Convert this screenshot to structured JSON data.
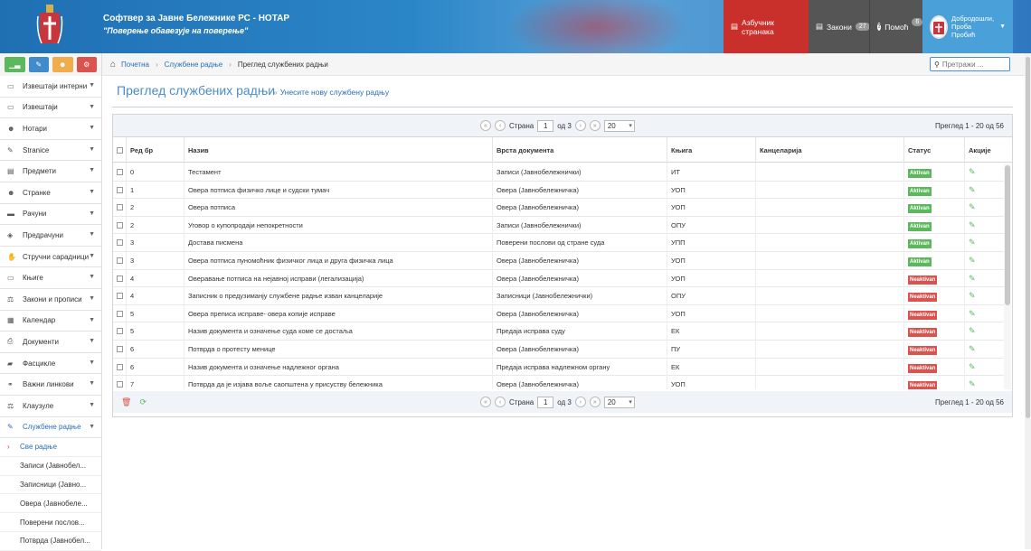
{
  "header": {
    "app_title": "Софтвер за Јавне Бележнике РС - НОТАР",
    "app_subtitle": "\"Поверење обавезује на поверење\"",
    "btn_alphabet": "Азбучник странака",
    "btn_laws": "Закони",
    "laws_count": "27",
    "btn_help": "Помоћ",
    "help_count": "6",
    "user_greeting": "Добродошли,",
    "user_first": "Проба",
    "user_last": "Пробић"
  },
  "sidebar": {
    "items": [
      {
        "label": "Извештаји интерни",
        "icon": "book-icon"
      },
      {
        "label": "Извештаји",
        "icon": "book-icon"
      },
      {
        "label": "Нотари",
        "icon": "users-icon"
      },
      {
        "label": "Stranice",
        "icon": "edit-icon"
      },
      {
        "label": "Предмети",
        "icon": "briefcase-icon"
      },
      {
        "label": "Странке",
        "icon": "users-icon"
      },
      {
        "label": "Рачуни",
        "icon": "credit-card-icon"
      },
      {
        "label": "Предрачуни",
        "icon": "tag-icon"
      },
      {
        "label": "Стручни сарадници",
        "icon": "handshake-icon"
      },
      {
        "label": "Књиге",
        "icon": "book-icon"
      },
      {
        "label": "Закони и прописи",
        "icon": "gavel-icon"
      },
      {
        "label": "Календар",
        "icon": "calendar-icon"
      },
      {
        "label": "Документи",
        "icon": "print-icon"
      },
      {
        "label": "Фасцикле",
        "icon": "folder-icon"
      },
      {
        "label": "Важни линкови",
        "icon": "link-icon"
      },
      {
        "label": "Клаузуле",
        "icon": "gavel-icon"
      },
      {
        "label": "Службене радње",
        "icon": "pencil-icon"
      }
    ],
    "subitems": [
      "Све радње",
      "Записи (Јавнобел...",
      "Записници (Јавно...",
      "Овера (Јавнобеле...",
      "Поверени послов...",
      "Потврда (Јавнобел..."
    ]
  },
  "breadcrumb": {
    "home": "Почетна",
    "section": "Службене радње",
    "current": "Преглед службених радњи"
  },
  "search": {
    "placeholder": "Претражи ..."
  },
  "page": {
    "title": "Преглед службених радњи",
    "new_link": "Унесите нову службену радњу"
  },
  "pager": {
    "page_label": "Страна",
    "page_value": "1",
    "of_label": "од 3",
    "per_page": "20",
    "range": "Преглед 1 - 20 од 56"
  },
  "columns": [
    "Ред бр",
    "Назив",
    "Врста документа",
    "Књига",
    "Канцеларија",
    "Статус",
    "Акције"
  ],
  "rows": [
    {
      "no": "0",
      "name": "Тестамент",
      "doctype": "Записи (Јавнобележнички)",
      "book": "ИТ",
      "office": "",
      "status": "Aktivan",
      "active": true
    },
    {
      "no": "1",
      "name": "Овера потписа физичко лице и судски тумач",
      "doctype": "Овера (Јавнобележничка)",
      "book": "УОП",
      "office": "",
      "status": "Aktivan",
      "active": true
    },
    {
      "no": "2",
      "name": "Овера потписа",
      "doctype": "Овера (Јавнобележничка)",
      "book": "УОП",
      "office": "",
      "status": "Aktivan",
      "active": true
    },
    {
      "no": "2",
      "name": "Уговор о купопродаји непокретности",
      "doctype": "Записи (Јавнобележнички)",
      "book": "ОПУ",
      "office": "",
      "status": "Aktivan",
      "active": true
    },
    {
      "no": "3",
      "name": "Достава писмена",
      "doctype": "Поверени послови од стране суда",
      "book": "УПП",
      "office": "",
      "status": "Aktivan",
      "active": true
    },
    {
      "no": "3",
      "name": "Овера потписа пуномоћник физичког лица и друга физичка лица",
      "doctype": "Овера (Јавнобележничка)",
      "book": "УОП",
      "office": "",
      "status": "Aktivan",
      "active": true
    },
    {
      "no": "4",
      "name": "Оверавање потписа на нејавној исправи (легализација)",
      "doctype": "Овера (Јавнобележничка)",
      "book": "УОП",
      "office": "",
      "status": "Neaktivan",
      "active": false
    },
    {
      "no": "4",
      "name": "Записник о предузиманју службене радње изван канцеларије",
      "doctype": "Записници (Јавнобележнички)",
      "book": "ОПУ",
      "office": "",
      "status": "Neaktivan",
      "active": false
    },
    {
      "no": "5",
      "name": "Овера преписа исправе- овера копије исправе",
      "doctype": "Овера (Јавнобележничка)",
      "book": "УОП",
      "office": "",
      "status": "Neaktivan",
      "active": false
    },
    {
      "no": "5",
      "name": "Назив документа и означење суда коме се достаља",
      "doctype": "Предаја исправа суду",
      "book": "ЕК",
      "office": "",
      "status": "Neaktivan",
      "active": false
    },
    {
      "no": "6",
      "name": "Потврда о протесту менице",
      "doctype": "Овера (Јавнобележничка)",
      "book": "ПУ",
      "office": "",
      "status": "Neaktivan",
      "active": false
    },
    {
      "no": "6",
      "name": "Назив документа и означење надлежног органа",
      "doctype": "Предаја исправа надлежном органу",
      "book": "ЕК",
      "office": "",
      "status": "Neaktivan",
      "active": false
    },
    {
      "no": "7",
      "name": "Потврда да је изјава воље саопштена у присуству бележника",
      "doctype": "Овера (Јавнобележничка)",
      "book": "УОП",
      "office": "",
      "status": "Neaktivan",
      "active": false
    }
  ],
  "colors": {
    "brand": "#2a6eb4",
    "active": "#5cb85c",
    "inactive": "#d9534f",
    "header_red": "#c9302c"
  }
}
